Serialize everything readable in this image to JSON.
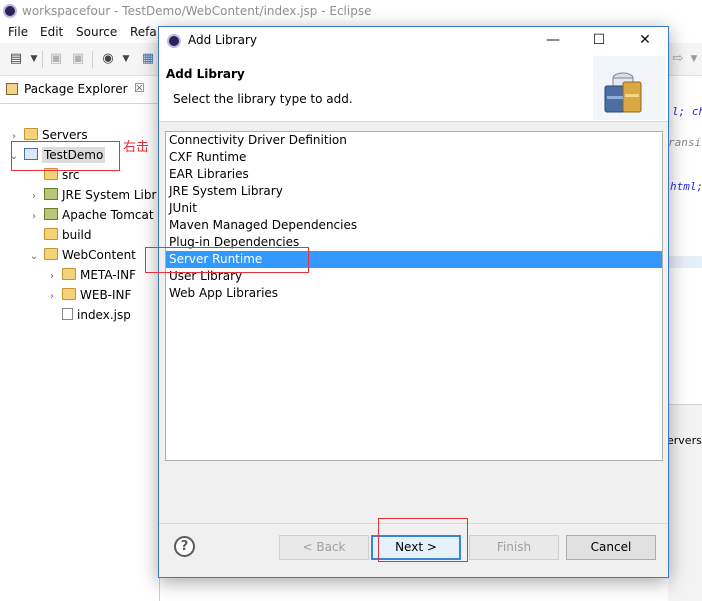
{
  "window": {
    "title": "workspacefour - TestDemo/WebContent/index.jsp - Eclipse",
    "menu": [
      "File",
      "Edit",
      "Source",
      "Refa"
    ]
  },
  "package_explorer": {
    "tab_label": "Package Explorer",
    "tab_close": "☒",
    "tree": [
      {
        "label": "Servers",
        "indent": 0,
        "expander": "›",
        "icon": "folder-icon"
      },
      {
        "label": "TestDemo",
        "indent": 0,
        "expander": "⌄",
        "icon": "project-icon",
        "selected": true
      },
      {
        "label": "src",
        "indent": 1,
        "expander": "",
        "icon": "package-folder-icon"
      },
      {
        "label": "JRE System Libr",
        "indent": 1,
        "expander": "›",
        "icon": "library-icon"
      },
      {
        "label": "Apache Tomcat",
        "indent": 1,
        "expander": "›",
        "icon": "library-icon"
      },
      {
        "label": "build",
        "indent": 1,
        "expander": "",
        "icon": "folder-icon"
      },
      {
        "label": "WebContent",
        "indent": 1,
        "expander": "⌄",
        "icon": "folder-icon"
      },
      {
        "label": "META-INF",
        "indent": 2,
        "expander": "›",
        "icon": "folder-icon"
      },
      {
        "label": "WEB-INF",
        "indent": 2,
        "expander": "›",
        "icon": "folder-icon"
      },
      {
        "label": "index.jsp",
        "indent": 2,
        "expander": "",
        "icon": "jsp-file-icon"
      }
    ],
    "annotation": "右击"
  },
  "editor_fragments": [
    "l; ch",
    "ransi",
    "html;",
    "ervers"
  ],
  "dialog": {
    "title": "Add Library",
    "header_title": "Add Library",
    "header_description": "Select the library type to add.",
    "library_types": [
      "Connectivity Driver Definition",
      "CXF Runtime",
      "EAR Libraries",
      "JRE System Library",
      "JUnit",
      "Maven Managed Dependencies",
      "Plug-in Dependencies",
      "Server Runtime",
      "User Library",
      "Web App Libraries"
    ],
    "selected_index": 7,
    "help": "?",
    "buttons": {
      "back": "< Back",
      "next": "Next >",
      "finish": "Finish",
      "cancel": "Cancel"
    },
    "window_controls": {
      "minimize": "—",
      "maximize": "☐",
      "close": "✕"
    }
  }
}
